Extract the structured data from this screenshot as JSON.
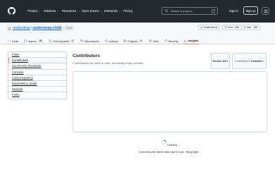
{
  "header": {
    "nav": [
      "Product",
      "Solutions",
      "Resources",
      "Open Source",
      "Enterprise",
      "Pricing"
    ],
    "search_placeholder": "Search or jump to...",
    "search_shortcut": "/",
    "sign_in": "Sign in",
    "sign_up": "Sign up"
  },
  "repo": {
    "owner": "understrap",
    "separator": "/",
    "name": "understrap-child",
    "visibility": "Public",
    "notifications_label": "Notifications",
    "fork_label": "Fork",
    "fork_count": "244",
    "star_label": "Star",
    "star_count": "329"
  },
  "tabs": [
    {
      "label": "Code",
      "count": "",
      "icon": "code-icon"
    },
    {
      "label": "Issues",
      "count": "28",
      "icon": "issue-icon"
    },
    {
      "label": "Pull requests",
      "count": "2",
      "icon": "pull-request-icon"
    },
    {
      "label": "Discussions",
      "count": "",
      "icon": "discussion-icon"
    },
    {
      "label": "Actions",
      "count": "",
      "icon": "actions-icon"
    },
    {
      "label": "Projects",
      "count": "0",
      "icon": "projects-icon"
    },
    {
      "label": "Wiki",
      "count": "",
      "icon": "wiki-icon"
    },
    {
      "label": "Security",
      "count": "",
      "icon": "shield-icon"
    },
    {
      "label": "Insights",
      "count": "",
      "icon": "graph-icon"
    }
  ],
  "sidenav": [
    "Pulse",
    "Contributors",
    "Community Standards",
    "Commits",
    "Code frequency",
    "Dependency graph",
    "Network",
    "Forks"
  ],
  "main": {
    "title": "Contributors",
    "subtitle": "Contributions per week to main, excluding merge commits",
    "period_label": "Period: All",
    "contributions_prefix": "Contributions:",
    "contributions_value": "Commits",
    "loading": "Loading",
    "crunching": "Crunching the latest data, just for you. Hang tight…"
  },
  "colors": {
    "header_bg": "#24292f",
    "link": "#0969da",
    "active_underline": "#fd8c73",
    "border": "#d0d7de"
  }
}
